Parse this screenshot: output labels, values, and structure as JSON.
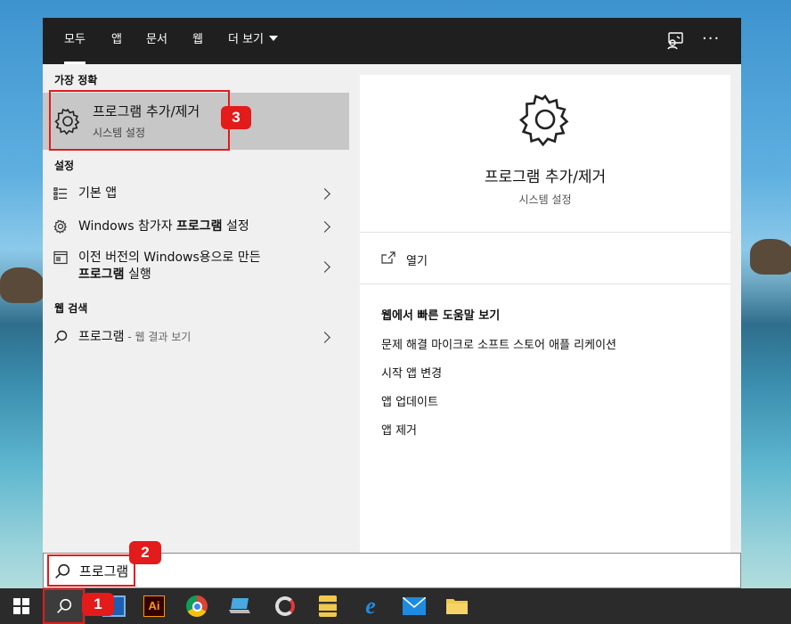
{
  "tabs": [
    {
      "label": "모두",
      "active": true
    },
    {
      "label": "앱"
    },
    {
      "label": "문서"
    },
    {
      "label": "웹"
    },
    {
      "label": "더 보기"
    }
  ],
  "topbar_icons": [
    "feedback-icon",
    "more-icon"
  ],
  "more_label": "···",
  "best_match": {
    "section": "가장 정확",
    "title": "프로그램 추가/제거",
    "subtitle": "시스템 설정"
  },
  "settings": {
    "section": "설정",
    "items": [
      {
        "icon": "list-icon",
        "text": "기본 앱"
      },
      {
        "icon": "gear-icon",
        "text_pre": "Windows 참가자 ",
        "text_bold": "프로그램",
        "text_post": " 설정"
      },
      {
        "icon": "compat-window-icon",
        "line1": "이전 버전의 Windows용으로 만든",
        "line2_bold": "프로그램",
        "line2_post": " 실행"
      }
    ]
  },
  "web_search": {
    "section": "웹 검색",
    "query": "프로그램",
    "suffix": " - 웹 결과 보기"
  },
  "preview": {
    "title": "프로그램 추가/제거",
    "subtitle": "시스템 설정",
    "open_label": "열기",
    "web_help_title": "웹에서 빠른 도움말 보기",
    "links": [
      "문제 해결 마이크로 소프트 스토어 애플 리케이션",
      "시작 앱 변경",
      "앱 업데이트",
      "앱 제거"
    ]
  },
  "search": {
    "value": "프로그램"
  },
  "taskbar": {
    "items": [
      "windows-start-icon",
      "search-icon",
      "terminal-icon",
      "illustrator-icon",
      "chrome-icon",
      "laptop-icon",
      "disk-icon",
      "archive-icon",
      "edge-icon",
      "mail-icon",
      "folder-icon"
    ],
    "illustrator_label": "Ai"
  },
  "annotations": [
    {
      "number": "1"
    },
    {
      "number": "2"
    },
    {
      "number": "3"
    }
  ],
  "colors": {
    "accent_red": "#e31b1b",
    "topbar": "#1f1f1f",
    "taskbar": "#2b2b2b",
    "highlight": "#c7c7c7"
  }
}
